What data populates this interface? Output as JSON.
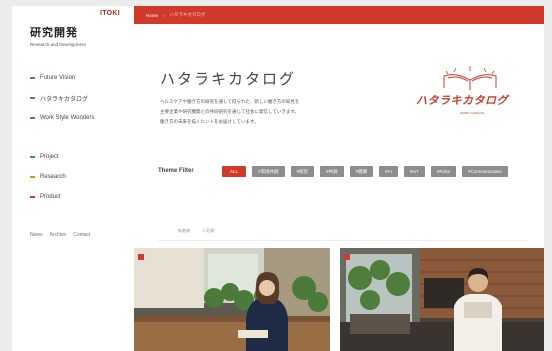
{
  "sidebar": {
    "logo": "ITOKI",
    "title": "研究開発",
    "subtitle": "Research and Development",
    "nav_primary": [
      {
        "label": "Future Vision",
        "color": "#3b82b5"
      },
      {
        "label": "ハタラキカタログ",
        "color": "#3b82b5"
      },
      {
        "label": "Work Style Wonders",
        "color": "#3b82b5"
      }
    ],
    "nav_secondary": [
      {
        "label": "Project",
        "color": "#3b82b5"
      },
      {
        "label": "Research",
        "color": "#e08a2b"
      },
      {
        "label": "Product",
        "color": "#d13a2a"
      }
    ],
    "footer": [
      "News",
      "Archive",
      "Contact"
    ]
  },
  "breadcrumb": {
    "home": "Home",
    "separator": "›",
    "current": "ハタラキカタログ"
  },
  "page": {
    "title": "ハタラキカタログ",
    "description": [
      "ヘルスケアや働き方の研究を通して得られた、新しい働き方の知見を",
      "主要企業や研究機関との共同研究を通じて社会に発信していきます。",
      "働き方の未来を描くヒントをお届けしています。"
    ]
  },
  "catalog_logo": {
    "text": "ハタラキカタログ",
    "sub": "WORK CATALOG",
    "color": "#d13a2a"
  },
  "filter": {
    "label": "Theme Filter",
    "tags": [
      "ALL",
      "#環境共創",
      "#研究",
      "#共創",
      "#健康",
      "#AI",
      "#IoT",
      "#Robo",
      "#Communication"
    ],
    "active_index": 0
  },
  "sort": {
    "options": [
      "新着順",
      "人気順"
    ]
  },
  "colors": {
    "accent": "#d13a2a",
    "tag_bg": "#8d8d8d"
  }
}
